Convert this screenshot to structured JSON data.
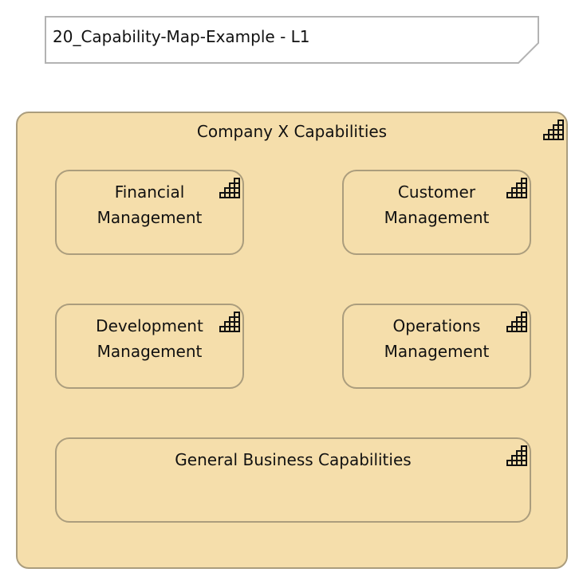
{
  "note": {
    "text": "20_Capability-Map-Example - L1"
  },
  "group": {
    "title": "Company X Capabilities",
    "icon": "capability-icon"
  },
  "capabilities": [
    {
      "label": "Financial Management",
      "icon": "capability-icon"
    },
    {
      "label": "Customer Management",
      "icon": "capability-icon"
    },
    {
      "label": "Development Management",
      "icon": "capability-icon"
    },
    {
      "label": "Operations Management",
      "icon": "capability-icon"
    },
    {
      "label": "General Business Capabilities",
      "icon": "capability-icon"
    }
  ],
  "colors": {
    "fill": "#f5deab",
    "border": "#ab9d7d",
    "note_border": "#b3b3b3"
  }
}
